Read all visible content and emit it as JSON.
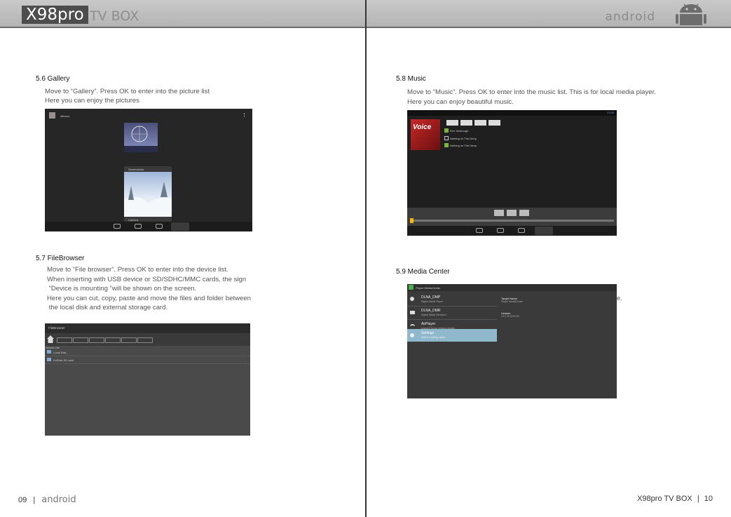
{
  "header": {
    "brand": "X98pro",
    "brand_sub": "TV BOX",
    "android_word": "android"
  },
  "left": {
    "gallery": {
      "title": "5.6 Gallery",
      "lines": [
        "Move to “Gallery”. Press OK to enter into the picture list",
        "Here you can enjoy the pictures"
      ],
      "screen": {
        "albums_label": "Albums",
        "folder_label": "Screenshots",
        "folder2_label": "Camera"
      }
    },
    "filebrowser": {
      "title": "5.7 FileBrowser",
      "lines": [
        "Move to “File browser”. Press OK to enter into the device list.",
        "When inserting with USB device or SD/SDHC/MMC cards, the sign",
        " ”Device is mounting ”will be shown on the screen.",
        "Here you can cut, copy, paste and move the files and folder between",
        " the local disk and external storage card."
      ],
      "screen": {
        "title": "FileBrowser",
        "devices_label": "Device List",
        "items": [
          "Local Disk",
          "ExtDisk SD card"
        ]
      }
    },
    "footer": {
      "page": "09",
      "sep": "|",
      "word": "android"
    }
  },
  "right": {
    "music": {
      "title": "5.8 Music",
      "lines": [
        "Move to “Music”. Press OK to enter into the music list. This is for local media player.",
        "Here you can enjoy beautiful music."
      ],
      "screen": {
        "album_text": "Voice",
        "tracks": [
          "Kim Yarbrough",
          "Nothing on The Deep",
          "Nothing on The Deep"
        ],
        "time": "17:00"
      }
    },
    "media_center": {
      "title": "5.9 Media Center",
      "screen": {
        "title": "Player MediaCenter",
        "items": [
          {
            "name": "DLNA_DMP",
            "sub": "Digital Media Player"
          },
          {
            "name": "DLNA_DMR",
            "sub": "Digital Media Renderer"
          },
          {
            "name": "AirPlayer",
            "sub": "support iTunes network display"
          },
          {
            "name": "Settings",
            "sub": "Select a setting option"
          }
        ],
        "target_label": "Target Name",
        "target_value": "Player MediaCenter",
        "version_label": "Version",
        "version_value": "V2.0 2012/07/30"
      },
      "stray": "e."
    },
    "footer": {
      "brand": "X98pro TV BOX",
      "sep": "|",
      "page": "10"
    }
  }
}
